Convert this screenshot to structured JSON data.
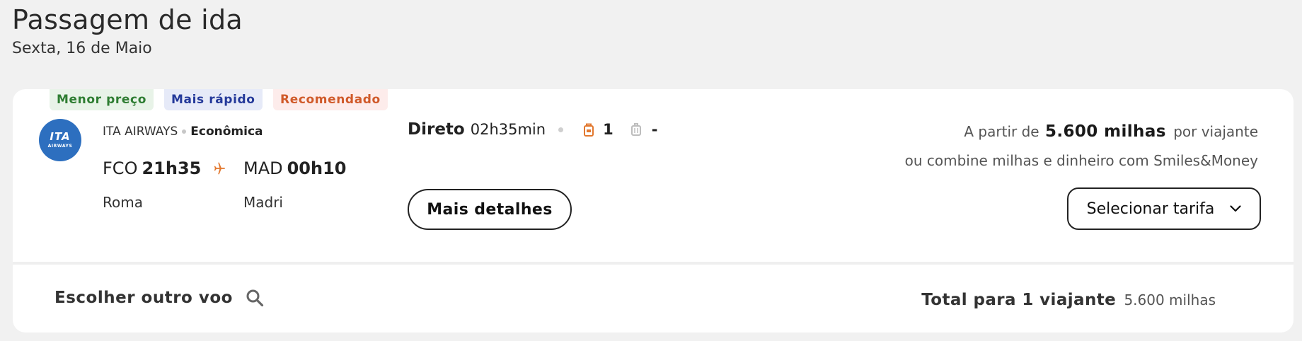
{
  "page": {
    "title": "Passagem de ida",
    "date": "Sexta, 16 de Maio"
  },
  "tags": {
    "lowest_price": "Menor preço",
    "fastest": "Mais rápido",
    "recommended": "Recomendado"
  },
  "flight": {
    "airline_logo_main": "ITA",
    "airline_logo_sub": "AIRWAYS",
    "airline": "ITA AIRWAYS",
    "cabin": "Econômica",
    "origin_code": "FCO",
    "departure_time": "21h35",
    "destination_code": "MAD",
    "arrival_time": "00h10",
    "origin_city": "Roma",
    "destination_city": "Madri",
    "stops_label": "Direto",
    "duration": "02h35min",
    "carry_on_count": "1",
    "checked_bag_count": "-"
  },
  "pricing": {
    "prefix": "A partir de",
    "miles": "5.600 milhas",
    "suffix": "por viajante",
    "alternative": "ou combine milhas e dinheiro com Smiles&Money"
  },
  "actions": {
    "details_label": "Mais detalhes",
    "select_fare_label": "Selecionar tarifa"
  },
  "footer": {
    "choose_other": "Escolher outro voo",
    "total_label": "Total para 1 viajante",
    "total_value": "5.600 milhas"
  },
  "colors": {
    "accent_orange": "#e2782f",
    "airline_blue": "#2d6fbf",
    "tag_green": "#2e7d32",
    "tag_blue": "#24399a",
    "tag_orange": "#d05a2a"
  },
  "icons": {
    "plane": "plane-icon",
    "carry_on": "backpack-icon",
    "checked_bag": "luggage-icon",
    "select_chevron": "chevron-down-icon",
    "search": "search-icon"
  }
}
